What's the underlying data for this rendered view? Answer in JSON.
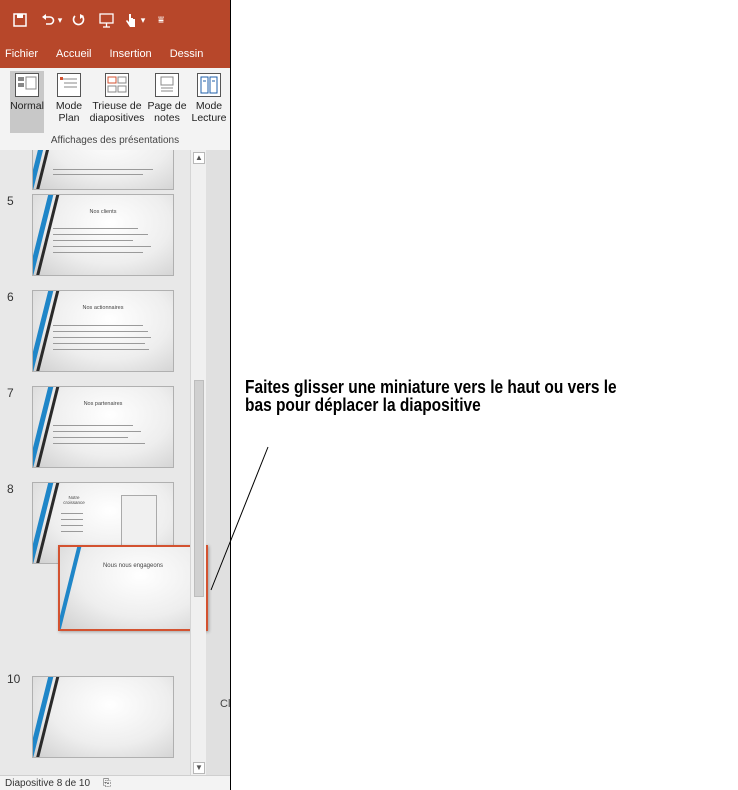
{
  "quick_access": {
    "save_icon": "save-icon",
    "undo_icon": "undo-icon",
    "redo_icon": "redo-icon",
    "present_icon": "present-from-start-icon",
    "touch_icon": "touch-mode-icon",
    "dropdown_glyph": "▾",
    "customize_glyph": "⩸"
  },
  "menu": {
    "tabs": [
      "Fichier",
      "Accueil",
      "Insertion",
      "Dessin"
    ]
  },
  "ribbon": {
    "buttons": [
      {
        "line1": "Normal",
        "line2": ""
      },
      {
        "line1": "Mode",
        "line2": "Plan"
      },
      {
        "line1": "Trieuse de",
        "line2": "diapositives"
      },
      {
        "line1": "Page de",
        "line2": "notes"
      },
      {
        "line1": "Mode",
        "line2": "Lecture"
      }
    ],
    "group_label": "Affichages des présentations"
  },
  "slides": [
    {
      "number": "",
      "title": ""
    },
    {
      "number": "5",
      "title": "Nos clients"
    },
    {
      "number": "6",
      "title": "Nos actionnaires"
    },
    {
      "number": "7",
      "title": "Nos partenaires"
    },
    {
      "number": "8",
      "title": "Notre croissance"
    },
    {
      "number": "10",
      "title": ""
    }
  ],
  "dragged_slide": {
    "title": "Nous nous engageons"
  },
  "partial_edge_text": "Cl",
  "status_bar": {
    "text": "Diapositive 8 de 10"
  },
  "callout": {
    "line1": "Faites glisser une miniature vers le haut ou vers le",
    "line2": "bas pour déplacer la diapositive"
  },
  "colors": {
    "accent": "#b7472a",
    "highlight_border": "#d35230"
  }
}
